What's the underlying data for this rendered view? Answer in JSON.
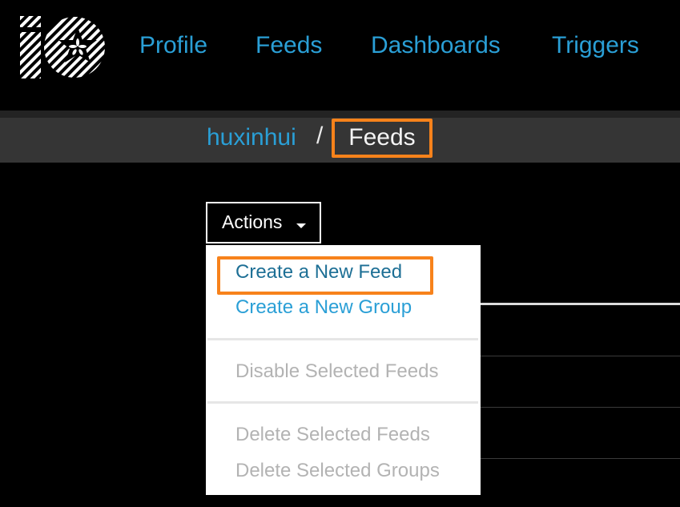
{
  "nav": {
    "logo_icon": "adafruit-io-logo-icon",
    "items": [
      {
        "label": "Profile"
      },
      {
        "label": "Feeds"
      },
      {
        "label": "Dashboards"
      },
      {
        "label": "Triggers"
      }
    ]
  },
  "breadcrumb": {
    "user": "huxinhui",
    "separator": "/",
    "current": "Feeds"
  },
  "actions": {
    "label": "Actions",
    "caret_icon": "caret-down-icon",
    "menu": [
      {
        "label": "Create a New Feed",
        "state": "hover"
      },
      {
        "label": "Create a New Group",
        "state": "enabled"
      },
      {
        "label": "Disable Selected Feeds",
        "state": "disabled"
      },
      {
        "label": "Delete Selected Feeds",
        "state": "disabled"
      },
      {
        "label": "Delete Selected Groups",
        "state": "disabled"
      }
    ]
  },
  "colors": {
    "link": "#2a9fd6",
    "link_hover": "#1d6f95",
    "highlight": "#f7821b",
    "disabled": "#b3b3b3",
    "breadcrumb_bg": "#353535"
  }
}
